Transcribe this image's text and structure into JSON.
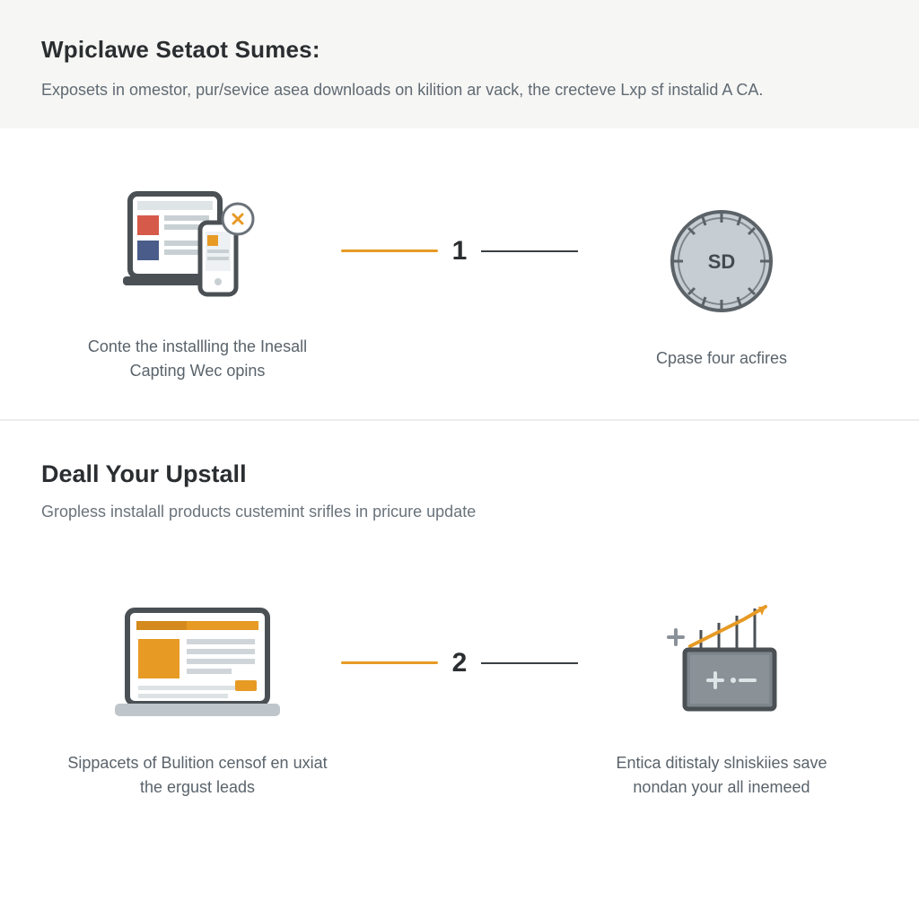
{
  "section1": {
    "heading": "Wpiclawe Setaot Sumes:",
    "subtext": "Exposets in omestor, pur/sevice asea downloads on kilition ar vack, the crecteve Lxp sf instalid A CA."
  },
  "step1": {
    "number": "1",
    "left_caption": "Conte the installling the Inesall Capting Wec opins",
    "right_caption": "Cpase four acfires",
    "dial_label": "SD"
  },
  "section2": {
    "heading": "Deall Your Upstall",
    "subtext": "Gropless instalall products custemint srifles in pricure update"
  },
  "step2": {
    "number": "2",
    "left_caption": "Sippacets of Bulition censof en uxiat the ergust leads",
    "right_caption": "Entica ditistaly slniskiies save nondan your all inemeed"
  },
  "colors": {
    "accent": "#e79a24",
    "dark": "#3a3f44",
    "muted": "#bfc6cb"
  }
}
